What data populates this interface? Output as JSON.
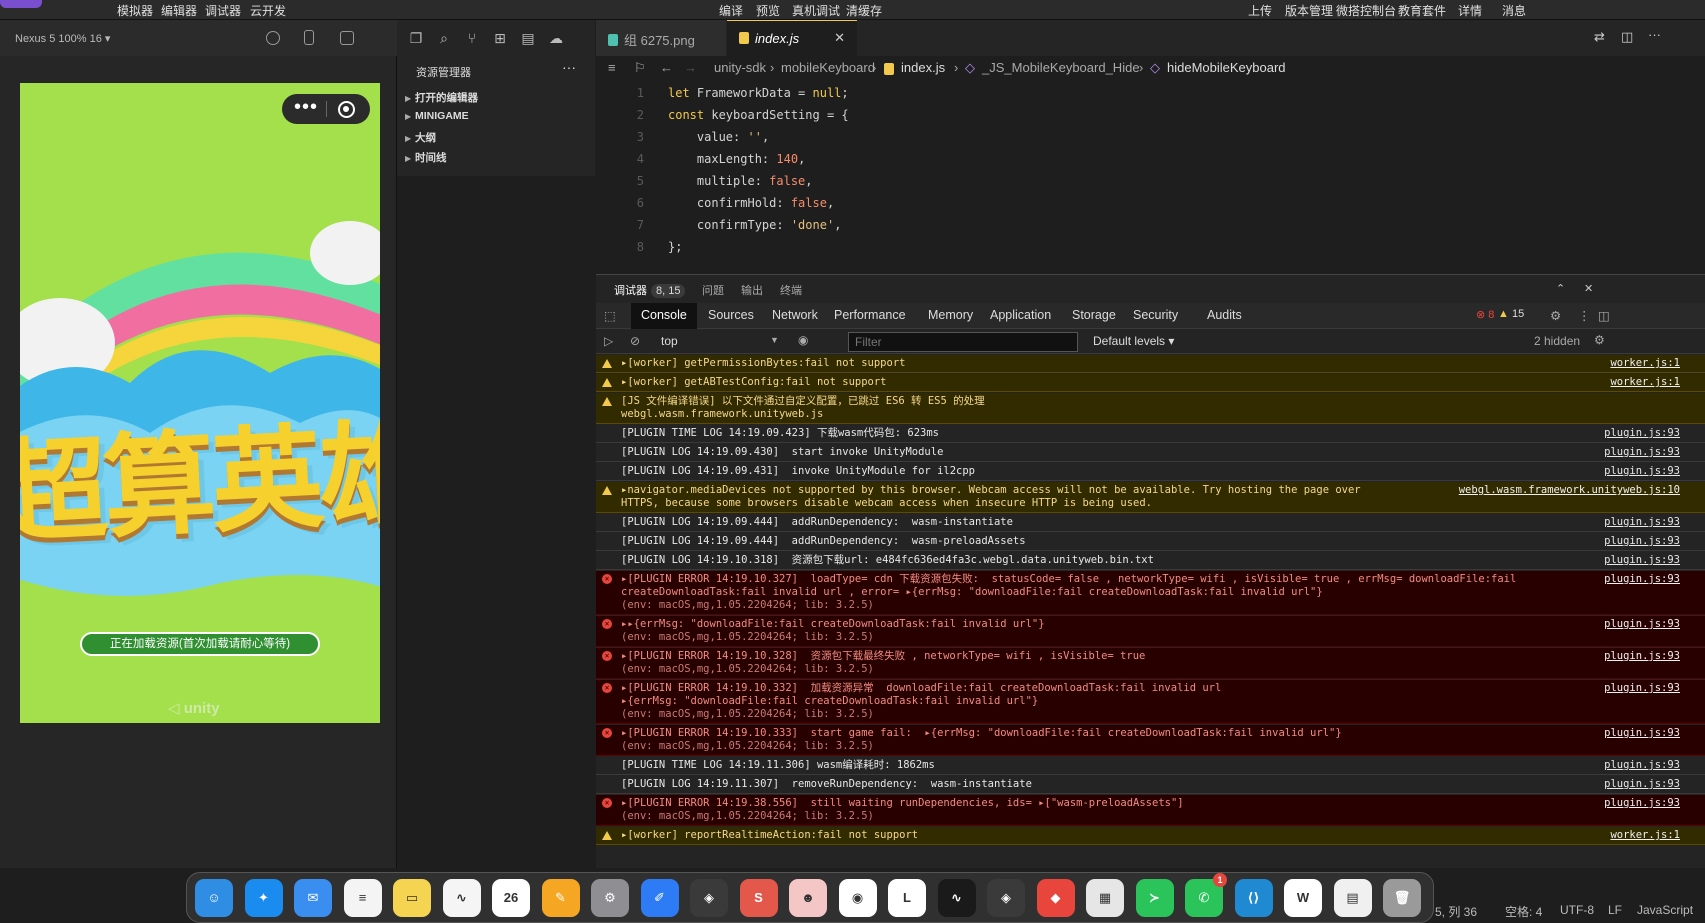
{
  "menu": {
    "left": [
      "模拟器",
      "编辑器",
      "调试器",
      "云开发"
    ],
    "center": [
      "编译",
      "预览",
      "真机调试",
      "清缓存"
    ],
    "right": [
      "上传",
      "版本管理",
      "微搭控制台",
      "教育套件",
      "详情",
      "消息"
    ]
  },
  "simulator": {
    "device": "Nexus 5 100% 16 ▾",
    "game_title": "超算英雄",
    "loading_text": "正在加载资源(首次加载请耐心等待)",
    "engine_logo": "unity"
  },
  "explorer": {
    "title": "资源管理器",
    "sections": [
      "打开的编辑器",
      "MINIGAME",
      "大纲",
      "时间线"
    ]
  },
  "editor": {
    "tabs": [
      {
        "label": "组 6275.png",
        "icon_color": "#4fc1b0"
      },
      {
        "label": "index.js",
        "icon_color": "#f2c94c"
      }
    ],
    "breadcrumb": [
      "unity-sdk",
      "mobileKeyboard",
      "index.js",
      "_JS_MobileKeyboard_Hide",
      "hideMobileKeyboard"
    ],
    "code_lines": [
      {
        "n": "1",
        "parts": [
          [
            "kw",
            "let "
          ],
          [
            "pr",
            "FrameworkData = "
          ],
          [
            "kw",
            "null"
          ],
          [
            "pr",
            ";"
          ]
        ]
      },
      {
        "n": "2",
        "parts": [
          [
            "kw",
            "const "
          ],
          [
            "pr",
            "keyboardSetting = {"
          ]
        ]
      },
      {
        "n": "3",
        "parts": [
          [
            "pr",
            "    value: "
          ],
          [
            "st",
            "''"
          ],
          [
            "pr",
            ","
          ]
        ]
      },
      {
        "n": "4",
        "parts": [
          [
            "pr",
            "    maxLength: "
          ],
          [
            "nm",
            "140"
          ],
          [
            "pr",
            ","
          ]
        ]
      },
      {
        "n": "5",
        "parts": [
          [
            "pr",
            "    multiple: "
          ],
          [
            "nm",
            "false"
          ],
          [
            "pr",
            ","
          ]
        ]
      },
      {
        "n": "6",
        "parts": [
          [
            "pr",
            "    confirmHold: "
          ],
          [
            "nm",
            "false"
          ],
          [
            "pr",
            ","
          ]
        ]
      },
      {
        "n": "7",
        "parts": [
          [
            "pr",
            "    confirmType: "
          ],
          [
            "st",
            "'done'"
          ],
          [
            "pr",
            ","
          ]
        ]
      },
      {
        "n": "8",
        "parts": [
          [
            "pr",
            "};"
          ]
        ]
      }
    ]
  },
  "debugger": {
    "tabs": [
      "调试器",
      "问题",
      "输出",
      "终端"
    ],
    "badge": "8, 15",
    "devtools_tabs": [
      "Console",
      "Sources",
      "Network",
      "Performance",
      "Memory",
      "Application",
      "Storage",
      "Security",
      "Audits"
    ],
    "error_count": "8",
    "warn_count": "15",
    "context": "top",
    "filter_placeholder": "Filter",
    "levels": "Default levels ▾",
    "hidden": "2 hidden"
  },
  "console": [
    {
      "type": "warn",
      "lines": [
        "▸[worker] getPermissionBytes:fail not support"
      ],
      "src": "worker.js:1"
    },
    {
      "type": "warn",
      "lines": [
        "▸[worker] getABTestConfig:fail not support"
      ],
      "src": "worker.js:1"
    },
    {
      "type": "warn",
      "lines": [
        "[JS 文件编译错误] 以下文件通过自定义配置，已跳过 ES6 转 ES5 的处理",
        "webgl.wasm.framework.unityweb.js"
      ],
      "src": ""
    },
    {
      "type": "log",
      "lines": [
        "[PLUGIN TIME LOG 14:19.09.423] 下载wasm代码包: 623ms"
      ],
      "src": "plugin.js:93"
    },
    {
      "type": "log",
      "lines": [
        "[PLUGIN LOG 14:19.09.430]  start invoke UnityModule"
      ],
      "src": "plugin.js:93"
    },
    {
      "type": "log",
      "lines": [
        "[PLUGIN LOG 14:19.09.431]  invoke UnityModule for il2cpp"
      ],
      "src": "plugin.js:93"
    },
    {
      "type": "warn",
      "lines": [
        "▸navigator.mediaDevices not supported by this browser. Webcam access will not be available. Try hosting the page over",
        "HTTPS, because some browsers disable webcam access when insecure HTTP is being used."
      ],
      "src": "webgl.wasm.framework.unityweb.js:10"
    },
    {
      "type": "log",
      "lines": [
        "[PLUGIN LOG 14:19.09.444]  addRunDependency:  wasm-instantiate"
      ],
      "src": "plugin.js:93"
    },
    {
      "type": "log",
      "lines": [
        "[PLUGIN LOG 14:19.09.444]  addRunDependency:  wasm-preloadAssets"
      ],
      "src": "plugin.js:93"
    },
    {
      "type": "log",
      "lines": [
        "[PLUGIN LOG 14:19.10.318]  资源包下载url: e484fc636ed4fa3c.webgl.data.unityweb.bin.txt"
      ],
      "src": "plugin.js:93"
    },
    {
      "type": "err",
      "lines": [
        "▸[PLUGIN ERROR 14:19.10.327]  loadType= cdn 下载资源包失败:  statusCode= false , networkType= wifi , isVisible= true , errMsg= downloadFile:fail",
        "createDownloadTask:fail invalid url , error= ▸{errMsg: \"downloadFile:fail createDownloadTask:fail invalid url\"}",
        "(env: macOS,mg,1.05.2204264; lib: 3.2.5)"
      ],
      "src": "plugin.js:93"
    },
    {
      "type": "err",
      "lines": [
        "▸▸{errMsg: \"downloadFile:fail createDownloadTask:fail invalid url\"}",
        "(env: macOS,mg,1.05.2204264; lib: 3.2.5)"
      ],
      "src": "plugin.js:93"
    },
    {
      "type": "err",
      "lines": [
        "▸[PLUGIN ERROR 14:19.10.328]  资源包下载最终失败 , networkType= wifi , isVisible= true",
        "(env: macOS,mg,1.05.2204264; lib: 3.2.5)"
      ],
      "src": "plugin.js:93"
    },
    {
      "type": "err",
      "lines": [
        "▸[PLUGIN ERROR 14:19.10.332]  加载资源异常  downloadFile:fail createDownloadTask:fail invalid url",
        "▸{errMsg: \"downloadFile:fail createDownloadTask:fail invalid url\"}",
        "(env: macOS,mg,1.05.2204264; lib: 3.2.5)"
      ],
      "src": "plugin.js:93"
    },
    {
      "type": "err",
      "lines": [
        "▸[PLUGIN ERROR 14:19.10.333]  start game fail:  ▸{errMsg: \"downloadFile:fail createDownloadTask:fail invalid url\"}",
        "(env: macOS,mg,1.05.2204264; lib: 3.2.5)"
      ],
      "src": "plugin.js:93"
    },
    {
      "type": "log",
      "lines": [
        "[PLUGIN TIME LOG 14:19.11.306] wasm编译耗时: 1862ms"
      ],
      "src": "plugin.js:93"
    },
    {
      "type": "log",
      "lines": [
        "[PLUGIN LOG 14:19.11.307]  removeRunDependency:  wasm-instantiate"
      ],
      "src": "plugin.js:93"
    },
    {
      "type": "err",
      "lines": [
        "▸[PLUGIN ERROR 14:19.38.556]  still waiting runDependencies, ids= ▸[\"wasm-preloadAssets\"]",
        "(env: macOS,mg,1.05.2204264; lib: 3.2.5)"
      ],
      "src": "plugin.js:93"
    },
    {
      "type": "warn",
      "lines": [
        "▸[worker] reportRealtimeAction:fail not support"
      ],
      "src": "worker.js:1"
    }
  ],
  "statusbar": [
    "5, 列 36",
    "空格: 4",
    "UTF-8",
    "LF",
    "JavaScript"
  ],
  "dock": [
    {
      "name": "Finder",
      "color": "#2f8de4",
      "glyph": "☺"
    },
    {
      "name": "Safari",
      "color": "#1a8cf0",
      "glyph": "✦"
    },
    {
      "name": "Mail",
      "color": "#3a8ef0",
      "glyph": "✉"
    },
    {
      "name": "Reminders",
      "color": "#f4f4f4",
      "glyph": "≡"
    },
    {
      "name": "Notes",
      "color": "#f5d451",
      "glyph": "▭"
    },
    {
      "name": "Freeform",
      "color": "#f5f5f5",
      "glyph": "∿"
    },
    {
      "name": "Calendar",
      "color": "#ffffff",
      "glyph": "26"
    },
    {
      "name": "Pages",
      "color": "#f5a623",
      "glyph": "✎"
    },
    {
      "name": "System Settings",
      "color": "#8e8e93",
      "glyph": "⚙"
    },
    {
      "name": "Pencil",
      "color": "#2d7cf6",
      "glyph": "✐"
    },
    {
      "name": "Unity Hub",
      "color": "#3a3a3a",
      "glyph": "◈"
    },
    {
      "name": "Sublime",
      "color": "#e4584b",
      "glyph": "S"
    },
    {
      "name": "Avatar App",
      "color": "#f5c6c6",
      "glyph": "☻"
    },
    {
      "name": "Chrome",
      "color": "#ffffff",
      "glyph": "◉"
    },
    {
      "name": "Lark",
      "color": "#ffffff",
      "glyph": "L"
    },
    {
      "name": "Activity Monitor",
      "color": "#1a1a1a",
      "glyph": "∿"
    },
    {
      "name": "Unity",
      "color": "#3a3a3a",
      "glyph": "◈"
    },
    {
      "name": "Kite",
      "color": "#e8453c",
      "glyph": "◆"
    },
    {
      "name": "Preview",
      "color": "#e6e6e6",
      "glyph": "▦"
    },
    {
      "name": "WeChat DevTools",
      "color": "#2bc45b",
      "glyph": "≻"
    },
    {
      "name": "WeChat",
      "color": "#2bc45b",
      "glyph": "✆",
      "badge": "1"
    },
    {
      "name": "VS Code",
      "color": "#1f8ad2",
      "glyph": "⟨⟩"
    },
    {
      "name": "WPS",
      "color": "#ffffff",
      "glyph": "W"
    },
    {
      "name": "Toolbox",
      "color": "#f0f0f0",
      "glyph": "▤"
    },
    {
      "name": "Trash",
      "color": "#9a9a9a",
      "glyph": "🗑"
    }
  ],
  "colors": {
    "accent": "#f2c94c",
    "error_bg": "#290000",
    "warn_bg": "#332b00"
  }
}
